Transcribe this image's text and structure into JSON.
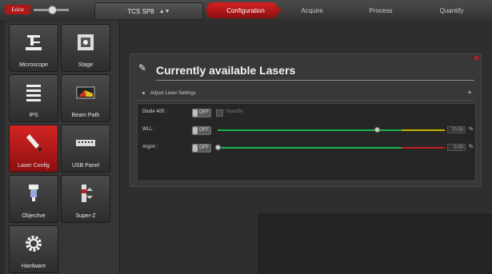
{
  "topbar": {
    "logo_text": "Leica",
    "system_name": "TCS SP8",
    "workflow_tabs": [
      {
        "label": "Configuration",
        "active": true
      },
      {
        "label": "Acquire",
        "active": false
      },
      {
        "label": "Process",
        "active": false
      },
      {
        "label": "Quantify",
        "active": false
      }
    ]
  },
  "sidebar": {
    "items": [
      {
        "label": "Microscope",
        "icon": "microscope-icon",
        "active": false
      },
      {
        "label": "Stage",
        "icon": "stage-icon",
        "active": false
      },
      {
        "label": "IPS",
        "icon": "ips-icon",
        "active": false
      },
      {
        "label": "Beam Path",
        "icon": "beam-path-icon",
        "active": false
      },
      {
        "label": "Laser Config",
        "icon": "laser-config-icon",
        "active": true
      },
      {
        "label": "USB Panel",
        "icon": "usb-panel-icon",
        "active": false
      },
      {
        "label": "Objective",
        "icon": "objective-icon",
        "active": false
      },
      {
        "label": "Super-Z",
        "icon": "super-z-icon",
        "active": false
      },
      {
        "label": "Hardware",
        "icon": "gear-icon",
        "active": false
      }
    ]
  },
  "panel": {
    "title": "Currently available Lasers",
    "section_label": "Adjust Laser Settings",
    "lasers": [
      {
        "name": "Diode 405 :",
        "toggle": "OFF",
        "standby_label": "Standby"
      },
      {
        "name": "WLL :",
        "toggle": "OFF",
        "value": "70.00",
        "unit": "%",
        "level": 0.7
      },
      {
        "name": "Argon :",
        "toggle": "OFF",
        "value": "0.00",
        "unit": "%",
        "level": 0.0
      }
    ]
  },
  "colors": {
    "accent": "#c41a1a",
    "slider_green": "#19b54a",
    "slider_yellow": "#c9b400",
    "slider_red": "#c02020"
  }
}
